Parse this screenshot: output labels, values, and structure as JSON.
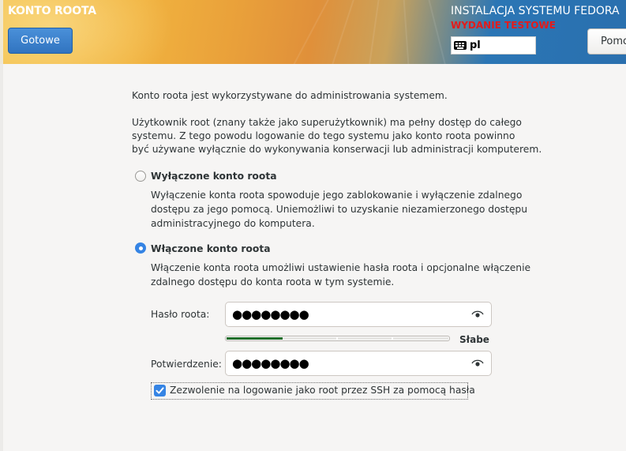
{
  "header": {
    "title": "KONTO ROOTA",
    "done_label": "Gotowe",
    "product_title": "INSTALACJA SYSTEMU FEDORA",
    "prerelease_label": "WYDANIE TESTOWE",
    "keyboard_layout": "pl",
    "help_label": "Pomoc!"
  },
  "content": {
    "intro": "Konto roota jest wykorzystywane do administrowania systemem.",
    "details_lines": [
      "Użytkownik root (znany także jako superużytkownik) ma pełny dostęp do całego",
      "systemu. Z tego powodu logowanie do tego systemu jako konto roota powinno",
      "być używane wyłącznie do wykonywania konserwacji lub administracji komputerem."
    ],
    "disable_option": {
      "title": "Wyłączone konto roota",
      "selected": false,
      "desc_lines": [
        "Wyłączenie konta roota spowoduje jego zablokowanie i wyłączenie zdalnego",
        "dostępu za jego pomocą. Uniemożliwi to uzyskanie niezamierzonego dostępu",
        "administracyjnego do komputera."
      ]
    },
    "enable_option": {
      "title": "Włączone konto roota",
      "selected": true,
      "desc_lines": [
        "Włączenie konta roota umożliwi ustawienie hasła roota i opcjonalne włączenie",
        "zdalnego dostępu do konta roota w tym systemie."
      ]
    },
    "password": {
      "label": "Hasło roota:",
      "value": "●●●●●●●●",
      "strength_label": "Słabe",
      "strength_fraction": 0.25
    },
    "confirm": {
      "label": "Potwierdzenie:",
      "value": "●●●●●●●●"
    },
    "ssh": {
      "label": "Zezwolenie na logowanie jako root przez SSH za pomocą hasła",
      "checked": true
    }
  },
  "colors": {
    "accent": "#3584e4",
    "prerelease": "#e31b1b",
    "strength_weak": "#1e6e2a"
  }
}
